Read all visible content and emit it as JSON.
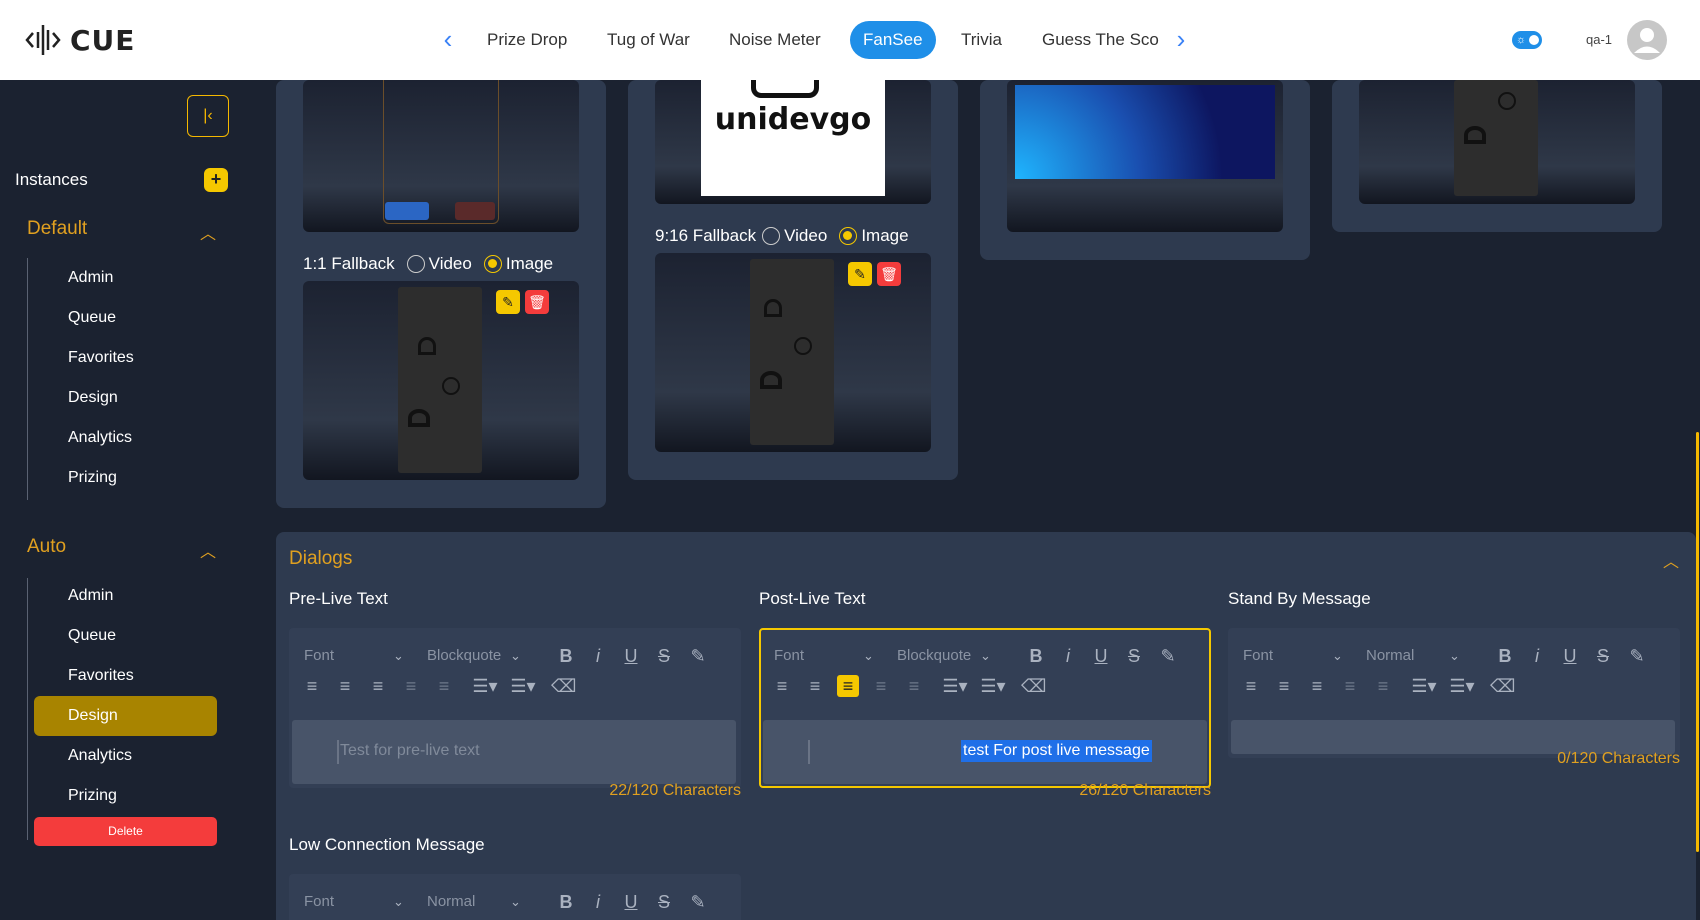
{
  "header": {
    "logo_text": "CUE",
    "tabs": [
      {
        "label": "Prize Drop",
        "active": false
      },
      {
        "label": "Tug of War",
        "active": false
      },
      {
        "label": "Noise Meter",
        "active": false
      },
      {
        "label": "FanSee",
        "active": true
      },
      {
        "label": "Trivia",
        "active": false
      },
      {
        "label": "Guess The Sco",
        "active": false
      }
    ],
    "prev_icon": "chevron-left-icon",
    "next_icon": "chevron-right-icon",
    "theme_toggle": "on",
    "user_name": "qa-1",
    "accent": "#1f8fe8"
  },
  "sidebar": {
    "instances_label": "Instances",
    "add_label": "+",
    "groups": [
      {
        "title": "Default",
        "expanded": true,
        "items": [
          "Admin",
          "Queue",
          "Favorites",
          "Design",
          "Analytics",
          "Prizing"
        ]
      },
      {
        "title": "Auto",
        "expanded": true,
        "items": [
          "Admin",
          "Queue",
          "Favorites",
          "Design",
          "Analytics",
          "Prizing"
        ],
        "active_item": "Design",
        "delete_label": "Delete"
      }
    ]
  },
  "media": {
    "fallback_1_1": {
      "label": "1:1 Fallback",
      "options": [
        "Video",
        "Image"
      ],
      "selected": "Image"
    },
    "fallback_9_16": {
      "label": "9:16 Fallback",
      "options": [
        "Video",
        "Image"
      ],
      "selected": "Image"
    },
    "sponsor_logo_text": "unidevgo"
  },
  "dialogs": {
    "title": "Dialogs",
    "editors": [
      {
        "label": "Pre-Live Text",
        "font": "Font",
        "style": "Blockquote",
        "value": "",
        "placeholder": "Test for pre-live text",
        "count": "22/120 Characters"
      },
      {
        "label": "Post-Live Text",
        "font": "Font",
        "style": "Blockquote",
        "value": "test For post live message",
        "count": "26/120 Characters"
      },
      {
        "label": "Stand By Message",
        "font": "Font",
        "style": "Normal",
        "value": "",
        "count": "0/120 Characters"
      },
      {
        "label": "Low Connection Message",
        "font": "Font",
        "style": "Normal"
      }
    ]
  },
  "colors": {
    "gold": "#f5c800",
    "orange_text": "#e0a020",
    "danger": "#f43c3c",
    "panel": "#2e3a4f",
    "background": "#1b2230"
  }
}
